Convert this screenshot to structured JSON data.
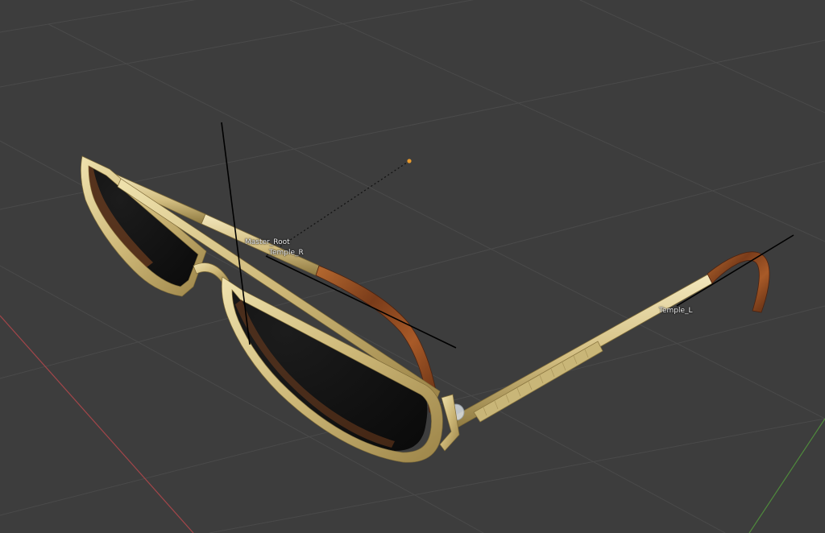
{
  "viewport": {
    "background_color": "#3d3d3d",
    "grid_color": "#4a4a4a",
    "x_axis_color": "#a4464a",
    "y_axis_color": "#4f8a3c"
  },
  "scene": {
    "object": "sunglasses",
    "materials": {
      "frame_gold": "#d6c488",
      "lens_dark": "#121212",
      "tortoise_shell": "#8a4a22"
    },
    "light_color": "#e89a2c"
  },
  "bones": {
    "master_root": "Master_Root",
    "temple_r": "Temple_R",
    "temple_l": "Temple_L"
  }
}
